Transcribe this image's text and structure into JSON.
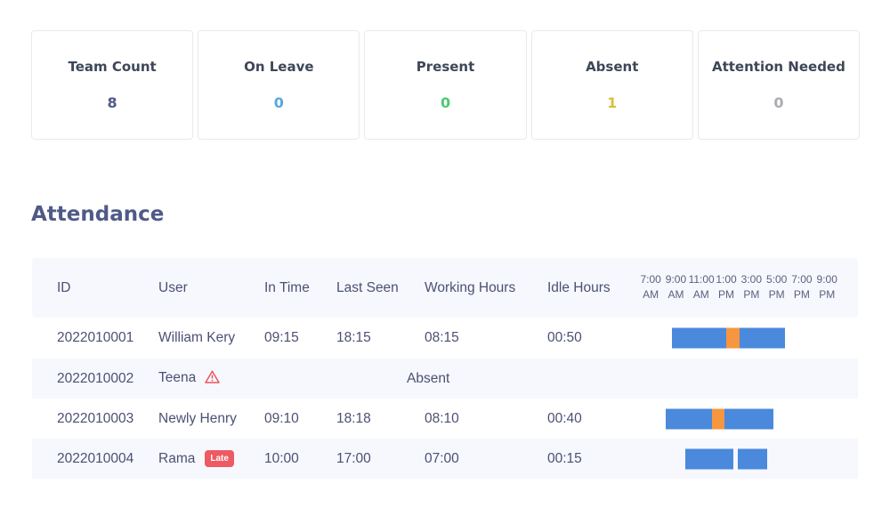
{
  "summary_cards": [
    {
      "label": "Team Count",
      "value": "8",
      "color": "#4f5a88"
    },
    {
      "label": "On Leave",
      "value": "0",
      "color": "#5aa6de"
    },
    {
      "label": "Present",
      "value": "0",
      "color": "#4ccb6e"
    },
    {
      "label": "Absent",
      "value": "1",
      "color": "#d7bf3f"
    },
    {
      "label": "Attention Needed",
      "value": "0",
      "color": "#a9abb0"
    }
  ],
  "section_title": "Attendance",
  "table": {
    "columns": [
      "ID",
      "User",
      "In Time",
      "Last Seen",
      "Working Hours",
      "Idle Hours"
    ],
    "timeline_labels": [
      [
        "7:00",
        "AM"
      ],
      [
        "9:00",
        "AM"
      ],
      [
        "11:00",
        "AM"
      ],
      [
        "1:00",
        "PM"
      ],
      [
        "3:00",
        "PM"
      ],
      [
        "5:00",
        "PM"
      ],
      [
        "7:00",
        "PM"
      ],
      [
        "9:00",
        "PM"
      ]
    ],
    "timeline_range_hours": [
      7,
      21
    ],
    "colors": {
      "active": "#4a89dc",
      "idle": "#f6963e"
    },
    "rows": [
      {
        "id": "2022010001",
        "user": "William Kery",
        "in_time": "09:15",
        "last_seen": "18:15",
        "working_hours": "08:15",
        "idle_hours": "00:50",
        "segments": [
          {
            "type": "active",
            "start": 9.25,
            "end": 13.6
          },
          {
            "type": "idle",
            "start": 13.6,
            "end": 14.65
          },
          {
            "type": "active",
            "start": 14.65,
            "end": 18.25
          }
        ]
      },
      {
        "id": "2022010002",
        "user": "Teena",
        "flag": "warning",
        "status": "Absent",
        "segments": []
      },
      {
        "id": "2022010003",
        "user": "Newly Henry",
        "in_time": "09:10",
        "last_seen": "18:18",
        "working_hours": "08:10",
        "idle_hours": "00:40",
        "segments": [
          {
            "type": "active",
            "start": 8.8,
            "end": 12.45
          },
          {
            "type": "idle",
            "start": 12.45,
            "end": 13.45
          },
          {
            "type": "active",
            "start": 13.45,
            "end": 17.35
          }
        ]
      },
      {
        "id": "2022010004",
        "user": "Rama",
        "badge": "Late",
        "in_time": "10:00",
        "last_seen": "17:00",
        "working_hours": "07:00",
        "idle_hours": "00:15",
        "segments": [
          {
            "type": "active",
            "start": 10.3,
            "end": 14.15
          },
          {
            "type": "gap",
            "start": 14.15,
            "end": 14.5
          },
          {
            "type": "active",
            "start": 14.5,
            "end": 16.8
          }
        ]
      }
    ]
  }
}
